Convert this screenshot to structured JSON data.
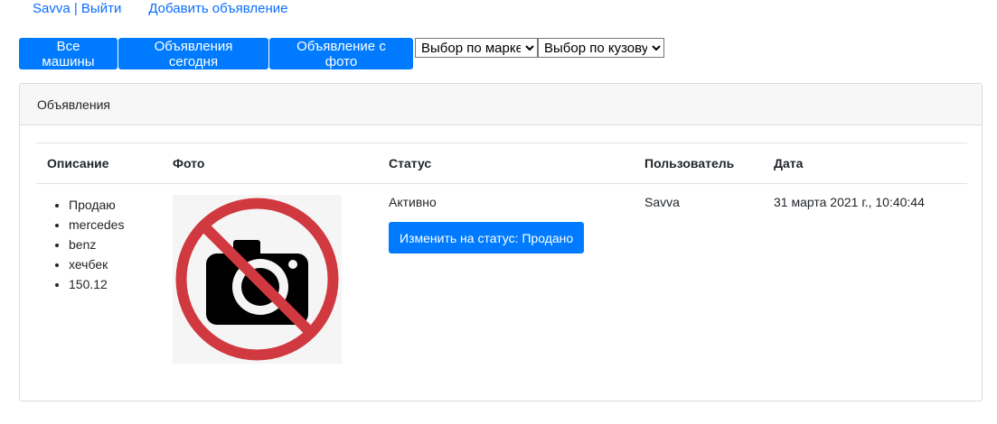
{
  "nav": {
    "user_link": "Savva | Выйти",
    "add_link": "Добавить объявление"
  },
  "toolbar": {
    "buttons": [
      "Все машины",
      "Объявления сегодня",
      "Объявление с фото"
    ],
    "brand_select": "Выбор по марке",
    "body_select": "Выбор по кузову"
  },
  "card": {
    "title": "Объявления",
    "columns": [
      "Описание",
      "Фото",
      "Статус",
      "Пользователь",
      "Дата"
    ],
    "rows": [
      {
        "description": [
          "Продаю",
          "mercedes",
          "benz",
          "хечбек",
          "150.12"
        ],
        "photo_icon": "no-photo-icon",
        "status": "Активно",
        "status_button": "Изменить на статус: Продано",
        "user": "Savva",
        "date": "31 марта 2021 г., 10:40:44"
      }
    ]
  },
  "colors": {
    "accent": "#007bff",
    "no_photo_red": "#d0393f"
  }
}
